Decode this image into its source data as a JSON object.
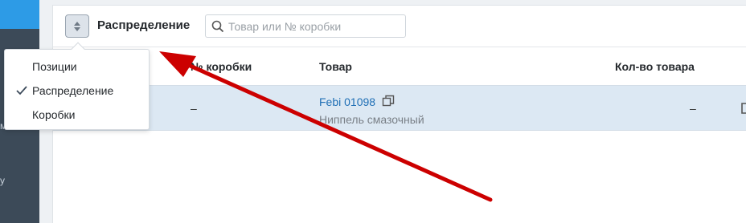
{
  "header": {
    "title": "Распределение",
    "search_placeholder": "Товар или № коробки"
  },
  "mode_menu": {
    "items": [
      {
        "label": "Позиции",
        "selected": false
      },
      {
        "label": "Распределение",
        "selected": true
      },
      {
        "label": "Коробки",
        "selected": false
      }
    ]
  },
  "table": {
    "columns": [
      "№ коробки",
      "Товар",
      "Кол-во товара"
    ],
    "rows": [
      {
        "box": "–",
        "item_code": "Febi 01098",
        "item_name": "Ниппель смазочный",
        "qty": "–"
      }
    ]
  },
  "colors": {
    "accent": "#2d9be6",
    "annotation_arrow": "#cc0000",
    "row_highlight": "#dce8f3",
    "link": "#1f6fb5"
  }
}
